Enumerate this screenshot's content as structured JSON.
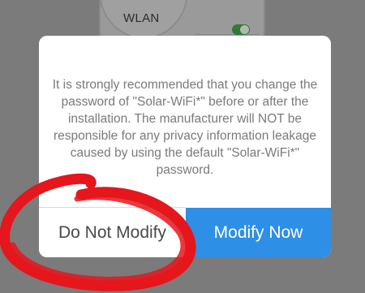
{
  "background": {
    "wlan_label": "WLAN"
  },
  "dialog": {
    "message": "It is strongly recommended that you change the password of \"Solar-WiFi*\" before or after the installation. The manufacturer will NOT be responsible for any privacy information leakage caused by using the default \"Solar-WiFi*\" password.",
    "secondary_button_label": "Do Not Modify",
    "primary_button_label": "Modify Now"
  },
  "colors": {
    "primary_button": "#2e8fe6",
    "annotation_stroke": "#e5161c",
    "overlay": "#7b7b7b"
  }
}
